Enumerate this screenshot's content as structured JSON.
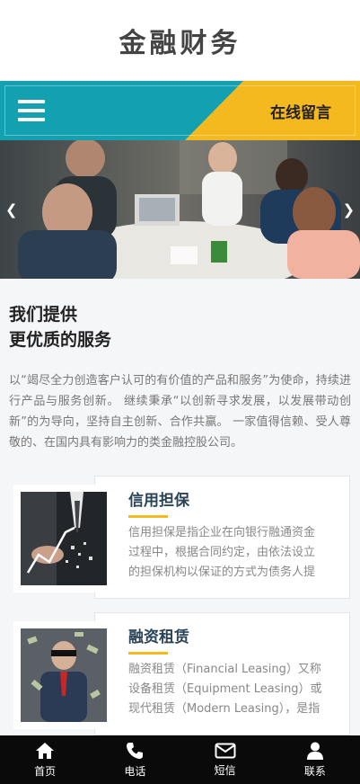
{
  "header": {
    "logo": "金融财务"
  },
  "nav": {
    "menu_icon": "hamburger-menu-icon",
    "message_label": "在线留言"
  },
  "banner": {
    "prev_icon": "chevron-left-icon",
    "next_icon": "chevron-right-icon"
  },
  "intro": {
    "title_line1": "我们提供",
    "title_line2": "更优质的服务",
    "paragraph": "以“竭尽全力创造客户认可的有价值的产品和服务”为使命，持续进行产品与服务创新。 继续秉承“以创新寻求发展，以发展带动创新”的为导向，坚持自主创新、合作共赢。 一家值得信赖、受人尊敬的、在国内具有影响力的类金融控股公司。"
  },
  "services": [
    {
      "title": "信用担保",
      "description": "信用担保是指企业在向银行融通资金过程中，根据合同约定，由依法设立的担保机构以保证的方式为债务人提供担保"
    },
    {
      "title": "融资租赁",
      "description": "融资租赁（Financial Leasing）又称设备租赁（Equipment Leasing）或现代租赁（Modern Leasing），是指实质上转移与资产所有权有关的全部或绝大部分风险和报酬的租赁"
    }
  ],
  "footer": {
    "items": [
      {
        "label": "首页",
        "icon": "home-icon"
      },
      {
        "label": "电话",
        "icon": "phone-icon"
      },
      {
        "label": "短信",
        "icon": "envelope-icon"
      },
      {
        "label": "联系",
        "icon": "user-icon"
      }
    ]
  },
  "colors": {
    "teal": "#13a0b0",
    "yellow": "#f5b920",
    "footer_bg": "#0a0a0a",
    "title_dark": "#2a4357"
  }
}
